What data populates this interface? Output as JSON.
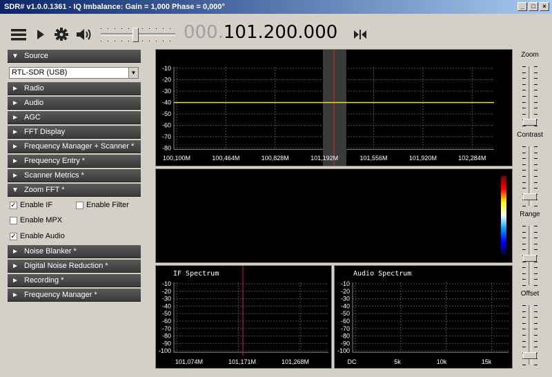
{
  "window": {
    "title": "SDR# v1.0.0.1361 - IQ Imbalance: Gain = 1,000 Phase = 0,000°",
    "buttons": [
      "_",
      "□",
      "×"
    ]
  },
  "toolbar": {
    "freq_dim": "000.",
    "freq_main": "101.200.000",
    "volume_level": 0.5
  },
  "left_panel": {
    "sections": [
      {
        "label": "Source",
        "expanded": true
      },
      {
        "label": "Radio",
        "expanded": false
      },
      {
        "label": "Audio",
        "expanded": false
      },
      {
        "label": "AGC",
        "expanded": false
      },
      {
        "label": "FFT Display",
        "expanded": false
      },
      {
        "label": "Frequency Manager + Scanner *",
        "expanded": false
      },
      {
        "label": "Frequency Entry *",
        "expanded": false
      },
      {
        "label": "Scanner Metrics *",
        "expanded": false
      },
      {
        "label": "Zoom FFT *",
        "expanded": true
      },
      {
        "label": "Noise Blanker *",
        "expanded": false
      },
      {
        "label": "Digital Noise Reduction *",
        "expanded": false
      },
      {
        "label": "Recording *",
        "expanded": false
      },
      {
        "label": "Frequency Manager *",
        "expanded": false
      }
    ],
    "source_device": "RTL-SDR (USB)",
    "zoom_fft": {
      "enable_if": {
        "label": "Enable IF",
        "checked": true
      },
      "enable_filter": {
        "label": "Enable Filter",
        "checked": false
      },
      "enable_mpx": {
        "label": "Enable MPX",
        "checked": false
      },
      "enable_audio": {
        "label": "Enable Audio",
        "checked": true
      }
    }
  },
  "spectrum": {
    "y_ticks": [
      "-10",
      "-20",
      "-30",
      "-40",
      "-50",
      "-60",
      "-70",
      "-80"
    ],
    "x_ticks": [
      "100,100M",
      "100,464M",
      "100,828M",
      "101,192M",
      "101,556M",
      "101,920M",
      "102,284M"
    ],
    "trace_level_db": -40
  },
  "if_spectrum": {
    "title": "IF Spectrum",
    "y_ticks": [
      "-10",
      "-20",
      "-30",
      "-40",
      "-50",
      "-60",
      "-70",
      "-80",
      "-90",
      "-100"
    ],
    "x_ticks": [
      "101,074M",
      "101,171M",
      "101,268M"
    ]
  },
  "audio_spectrum": {
    "title": "Audio Spectrum",
    "y_ticks": [
      "-10",
      "-20",
      "-30",
      "-40",
      "-50",
      "-60",
      "-70",
      "-80",
      "-90",
      "-100"
    ],
    "x_ticks": [
      "DC",
      "5k",
      "10k",
      "15k"
    ]
  },
  "right_sliders": [
    {
      "label": "Zoom",
      "level": 0.0
    },
    {
      "label": "Contrast",
      "level": 0.1
    },
    {
      "label": "Range",
      "level": 0.45
    },
    {
      "label": "Offset",
      "level": 0.1
    }
  ],
  "colors": {
    "trace": "#e8e800",
    "center_line": "#e02020",
    "grid": "#505050"
  }
}
